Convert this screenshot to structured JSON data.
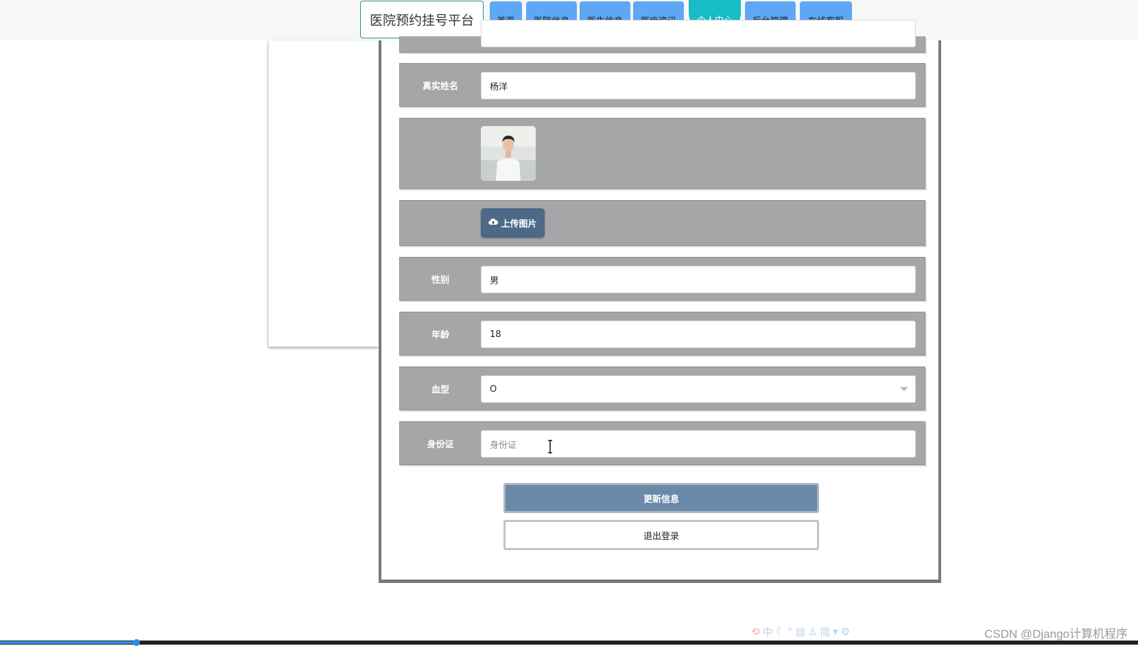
{
  "nav": {
    "site_title": "医院预约挂号平台",
    "items": [
      {
        "label": "首页"
      },
      {
        "label": "医院信息"
      },
      {
        "label": "医生信息"
      },
      {
        "label": "医疗资讯"
      },
      {
        "label": "个人中心"
      },
      {
        "label": "后台管理"
      },
      {
        "label": "在线客服"
      }
    ],
    "active_index": 4
  },
  "form": {
    "real_name": {
      "label": "真实姓名",
      "value": "杨洋"
    },
    "upload_label": "上传图片",
    "gender": {
      "label": "性别",
      "value": "男"
    },
    "age": {
      "label": "年龄",
      "value": "18"
    },
    "blood_type": {
      "label": "血型",
      "value": "O"
    },
    "id_card": {
      "label": "身份证",
      "placeholder": "身份证"
    },
    "update_button": "更新信息",
    "logout_button": "退出登录"
  },
  "ime_toolbar": {
    "mode": "中"
  },
  "watermark": "CSDN @Django计算机程序",
  "video_progress": 0.12,
  "colors": {
    "nav_item": "#5fa7f5",
    "nav_active": "#17bcc4",
    "row_bg": "#a6a6a8",
    "update_button": "#6a88a8",
    "upload_button": "#4c6a88"
  }
}
